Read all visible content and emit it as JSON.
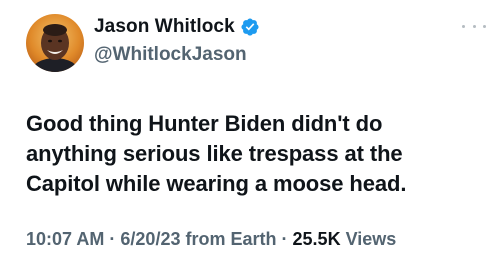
{
  "author": {
    "display_name": "Jason Whitlock",
    "handle": "@WhitlockJason",
    "verified": true,
    "verified_color": "#1d9bf0"
  },
  "tweet": {
    "text_lines": [
      "Good thing Hunter Biden didn't do",
      "anything serious like trespass at the",
      "Capitol while wearing a moose head."
    ]
  },
  "meta": {
    "time": "10:07 AM",
    "separator": "·",
    "date": "6/20/23",
    "source": "from Earth",
    "views_count": "25.5K",
    "views_label": "Views"
  },
  "icons": {
    "more": "more-horizontal-icon",
    "verified": "verified-badge-icon"
  },
  "colors": {
    "text_primary": "#0f1419",
    "text_secondary": "#536471",
    "accent": "#1d9bf0"
  }
}
